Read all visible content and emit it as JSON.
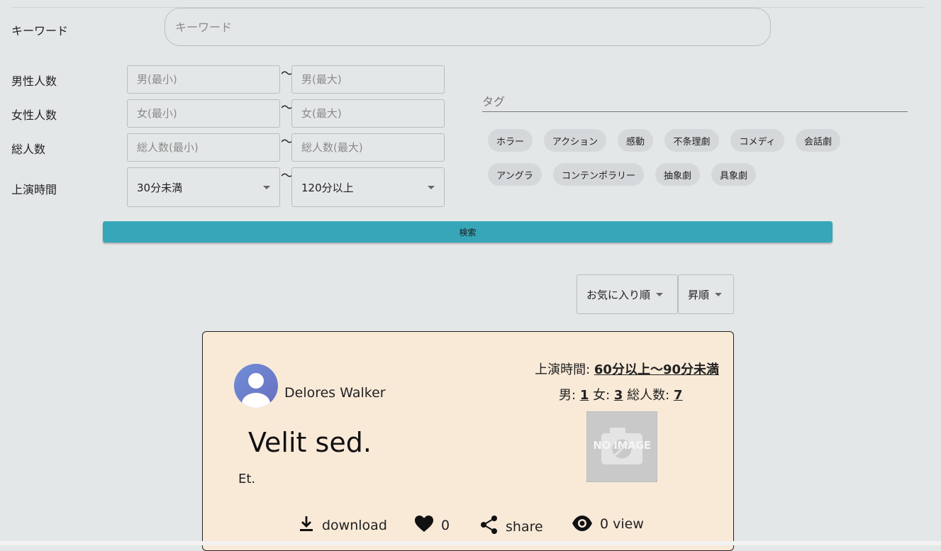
{
  "keyword": {
    "label": "キーワード",
    "placeholder": "キーワード"
  },
  "filters": {
    "male": {
      "label": "男性人数",
      "min_placeholder": "男(最小)",
      "max_placeholder": "男(最大)"
    },
    "female": {
      "label": "女性人数",
      "min_placeholder": "女(最小)",
      "max_placeholder": "女(最大)"
    },
    "total": {
      "label": "総人数",
      "min_placeholder": "総人数(最小)",
      "max_placeholder": "総人数(最大)"
    },
    "duration": {
      "label": "上演時間",
      "min_value": "30分未満",
      "max_value": "120分以上"
    },
    "tilde": "〜"
  },
  "tags": {
    "label": "タグ",
    "items": [
      "ホラー",
      "アクション",
      "感動",
      "不条理劇",
      "コメディ",
      "会話劇",
      "アングラ",
      "コンテンポラリー",
      "抽象劇",
      "具象劇"
    ]
  },
  "search_button": "検索",
  "sort": {
    "order_by": "お気に入り順",
    "direction": "昇順"
  },
  "card": {
    "author": "Delores Walker",
    "duration_label": "上演時間:",
    "duration_value": "60分以上〜90分未満",
    "male_label": "男:",
    "male_value": "1",
    "female_label": "女:",
    "female_value": "3",
    "total_label": "総人数:",
    "total_value": "7",
    "thumbnail_text": "NO IMAGE",
    "title": "Velit sed.",
    "description": "Et.",
    "actions": {
      "download": "download",
      "likes": "0",
      "share": "share",
      "views": "0 view"
    }
  },
  "colors": {
    "accent": "#37a6b9",
    "card_bg": "#f9ead8",
    "page_bg": "#e4e7e8"
  }
}
